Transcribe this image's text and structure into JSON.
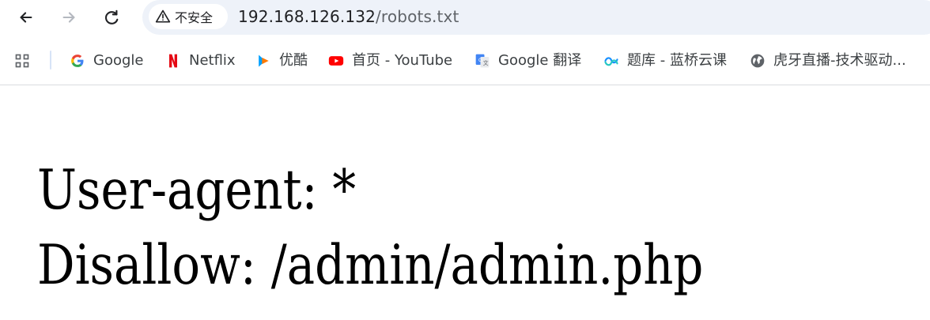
{
  "browser": {
    "security_label": "不安全",
    "url_host": "192.168.126.132",
    "url_path": "/robots.txt"
  },
  "bookmarks": [
    {
      "label": "Google",
      "icon": "google-icon"
    },
    {
      "label": "Netflix",
      "icon": "netflix-icon"
    },
    {
      "label": "优酷",
      "icon": "youku-icon"
    },
    {
      "label": "首页 - YouTube",
      "icon": "youtube-icon"
    },
    {
      "label": "Google 翻译",
      "icon": "google-translate-icon"
    },
    {
      "label": "题库 - 蓝桥云课",
      "icon": "lanqiao-icon"
    },
    {
      "label": "虎牙直播-技术驱动...",
      "icon": "globe-icon"
    }
  ],
  "robots": {
    "line1": "User-agent: *",
    "line2": "Disallow: /admin/admin.php"
  },
  "colors": {
    "omnibox_background": "#eef2f9",
    "page_text": "#000000",
    "browser_text": "#202124",
    "bookmark_text": "#3c4043",
    "netflix_red": "#e50914",
    "youtube_red": "#ff0000",
    "google_blue": "#4285f4"
  }
}
